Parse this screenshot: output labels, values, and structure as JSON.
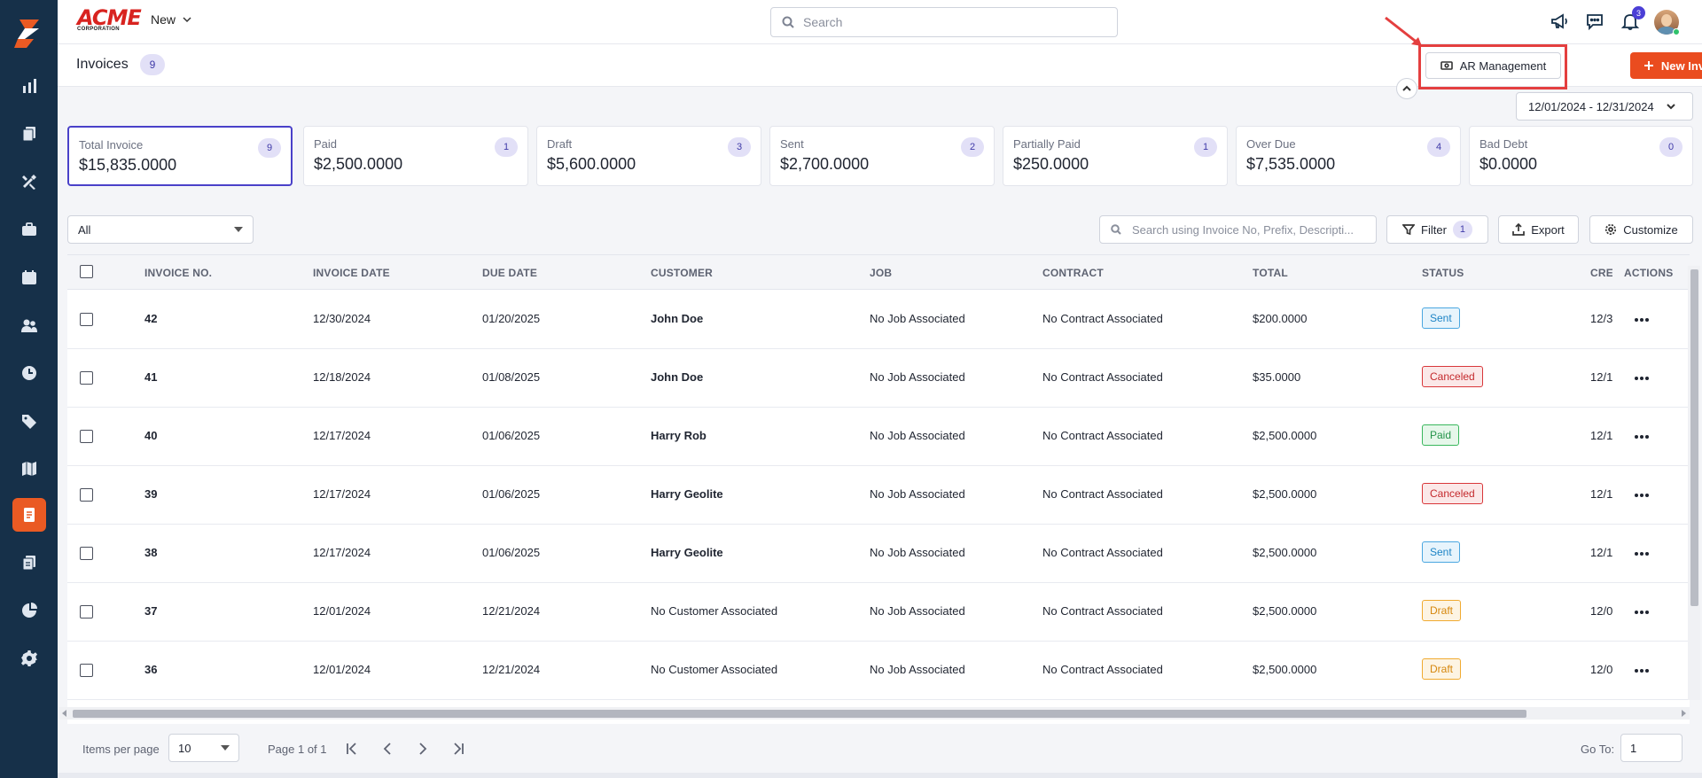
{
  "app": {
    "brand_name": "ACME",
    "brand_sub": "CORPORATION",
    "new_menu_label": "New",
    "search_placeholder": "Search",
    "notifications_count": "3"
  },
  "sidebar": {
    "items": [
      {
        "icon": "chart-icon"
      },
      {
        "icon": "documents-icon"
      },
      {
        "icon": "tools-icon"
      },
      {
        "icon": "briefcase-icon"
      },
      {
        "icon": "calendar-icon"
      },
      {
        "icon": "users-icon"
      },
      {
        "icon": "clock-icon"
      },
      {
        "icon": "tag-icon"
      },
      {
        "icon": "map-icon"
      },
      {
        "icon": "invoice-icon",
        "active": true
      },
      {
        "icon": "copy-icon"
      },
      {
        "icon": "pie-icon"
      },
      {
        "icon": "gear-icon"
      }
    ]
  },
  "header": {
    "title": "Invoices",
    "count": "9",
    "ar_button": "AR Management",
    "new_button": "New Invoice",
    "date_range": "12/01/2024 - 12/31/2024"
  },
  "cards": [
    {
      "label": "Total Invoice",
      "value": "$15,835.0000",
      "count": "9",
      "selected": true
    },
    {
      "label": "Paid",
      "value": "$2,500.0000",
      "count": "1"
    },
    {
      "label": "Draft",
      "value": "$5,600.0000",
      "count": "3"
    },
    {
      "label": "Sent",
      "value": "$2,700.0000",
      "count": "2"
    },
    {
      "label": "Partially Paid",
      "value": "$250.0000",
      "count": "1"
    },
    {
      "label": "Over Due",
      "value": "$7,535.0000",
      "count": "4"
    },
    {
      "label": "Bad Debt",
      "value": "$0.0000",
      "count": "0"
    }
  ],
  "controls": {
    "status_filter": "All",
    "search_placeholder": "Search using Invoice No, Prefix, Descripti...",
    "filter_label": "Filter",
    "filter_count": "1",
    "export_label": "Export",
    "customize_label": "Customize"
  },
  "table": {
    "columns": [
      "INVOICE NO.",
      "INVOICE DATE",
      "DUE DATE",
      "CUSTOMER",
      "JOB",
      "CONTRACT",
      "TOTAL",
      "STATUS",
      "CRE",
      "ACTIONS"
    ],
    "rows": [
      {
        "invoice_no": "42",
        "invoice_date": "12/30/2024",
        "due_date": "01/20/2025",
        "customer": "John Doe",
        "customer_bold": true,
        "job": "No Job Associated",
        "contract": "No Contract Associated",
        "total": "$200.0000",
        "status": "Sent",
        "created": "12/3"
      },
      {
        "invoice_no": "41",
        "invoice_date": "12/18/2024",
        "due_date": "01/08/2025",
        "customer": "John Doe",
        "customer_bold": true,
        "job": "No Job Associated",
        "contract": "No Contract Associated",
        "total": "$35.0000",
        "status": "Canceled",
        "created": "12/1"
      },
      {
        "invoice_no": "40",
        "invoice_date": "12/17/2024",
        "due_date": "01/06/2025",
        "customer": "Harry Rob",
        "customer_bold": true,
        "job": "No Job Associated",
        "contract": "No Contract Associated",
        "total": "$2,500.0000",
        "status": "Paid",
        "created": "12/1"
      },
      {
        "invoice_no": "39",
        "invoice_date": "12/17/2024",
        "due_date": "01/06/2025",
        "customer": "Harry Geolite",
        "customer_bold": true,
        "job": "No Job Associated",
        "contract": "No Contract Associated",
        "total": "$2,500.0000",
        "status": "Canceled",
        "created": "12/1"
      },
      {
        "invoice_no": "38",
        "invoice_date": "12/17/2024",
        "due_date": "01/06/2025",
        "customer": "Harry Geolite",
        "customer_bold": true,
        "job": "No Job Associated",
        "contract": "No Contract Associated",
        "total": "$2,500.0000",
        "status": "Sent",
        "created": "12/1"
      },
      {
        "invoice_no": "37",
        "invoice_date": "12/01/2024",
        "due_date": "12/21/2024",
        "customer": "No Customer Associated",
        "customer_bold": false,
        "job": "No Job Associated",
        "contract": "No Contract Associated",
        "total": "$2,500.0000",
        "status": "Draft",
        "created": "12/0"
      },
      {
        "invoice_no": "36",
        "invoice_date": "12/01/2024",
        "due_date": "12/21/2024",
        "customer": "No Customer Associated",
        "customer_bold": false,
        "job": "No Job Associated",
        "contract": "No Contract Associated",
        "total": "$2,500.0000",
        "status": "Draft",
        "created": "12/0"
      }
    ]
  },
  "pagination": {
    "items_per_page_label": "Items per page",
    "items_per_page": "10",
    "page_info": "Page 1 of 1",
    "goto_label": "Go To:",
    "goto_value": "1"
  },
  "colors": {
    "sidebar_bg": "#163049",
    "accent": "#ea4c1f",
    "selected_card_border": "#4a41c9",
    "highlight": "#e43f3f"
  }
}
